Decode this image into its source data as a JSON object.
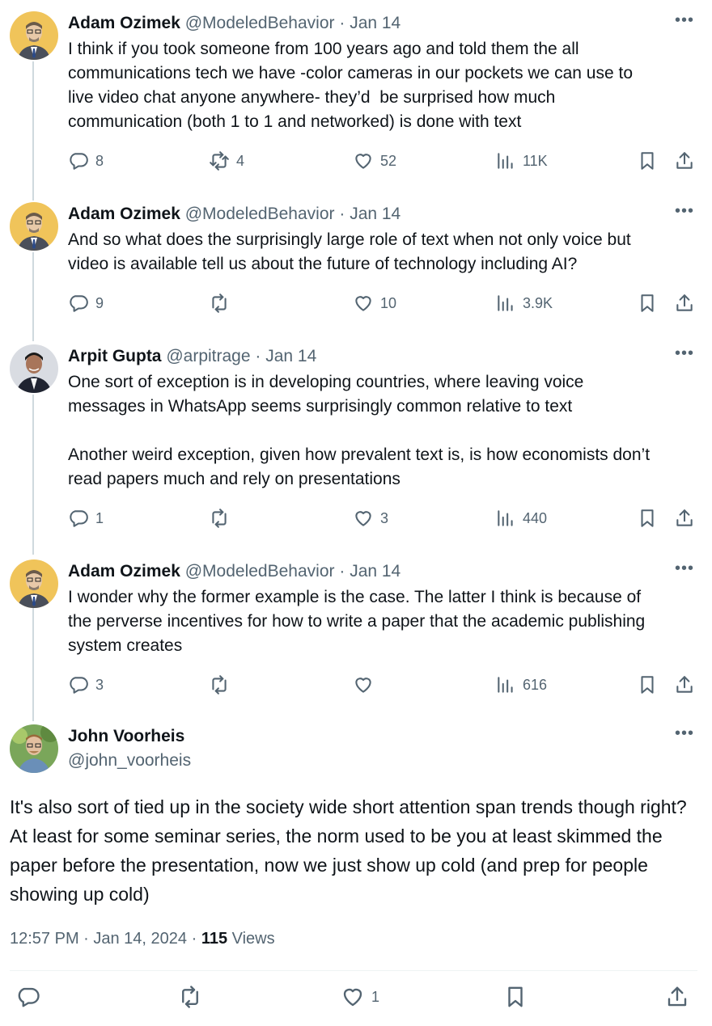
{
  "tweets": [
    {
      "name": "Adam Ozimek",
      "handle": "@ModeledBehavior",
      "dot": "·",
      "date": "Jan 14",
      "more": "•••",
      "text": "I think if you took someone from 100 years ago and told them the all\ncommunications tech we have -color cameras in our pockets we can use to\nlive video chat anyone anywhere- they’d  be surprised how much\ncommunication (both 1 to 1 and networked) is done with text",
      "replies": "8",
      "retweets": "4",
      "likes": "52",
      "views": "11K"
    },
    {
      "name": "Adam Ozimek",
      "handle": "@ModeledBehavior",
      "dot": "·",
      "date": "Jan 14",
      "more": "•••",
      "text": "And so what does the surprisingly large role of text when not only voice but\nvideo is available tell us about the future of technology including AI?",
      "replies": "9",
      "retweets": "",
      "likes": "10",
      "views": "3.9K"
    },
    {
      "name": "Arpit Gupta",
      "handle": "@arpitrage",
      "dot": "·",
      "date": "Jan 14",
      "more": "•••",
      "text": "One sort of exception is in developing countries, where leaving voice\nmessages in WhatsApp seems surprisingly common relative to text\n\nAnother weird exception, given how prevalent text is, is how economists don’t\nread papers much and rely on presentations",
      "replies": "1",
      "retweets": "",
      "likes": "3",
      "views": "440"
    },
    {
      "name": "Adam Ozimek",
      "handle": "@ModeledBehavior",
      "dot": "·",
      "date": "Jan 14",
      "more": "•••",
      "text": "I wonder why the former example is the case. The latter I think is because of\nthe perverse incentives for how to write a paper that the academic publishing\nsystem creates",
      "replies": "3",
      "retweets": "",
      "likes": "",
      "views": "616"
    }
  ],
  "main": {
    "name": "John Voorheis",
    "handle": "@john_voorheis",
    "more": "•••",
    "text": "It's also sort of tied up in the society wide short attention span trends though right? At least for some seminar series, the norm used to be you at least skimmed the paper before the presentation, now we just show up cold (and prep for people showing up cold)",
    "time": "12:57 PM · Jan 14, 2024 · ",
    "views_count": "115",
    "views_label": " Views",
    "likes": "1"
  },
  "icons": {
    "reply": "reply-icon",
    "retweet": "retweet-icon",
    "like": "heart-icon",
    "views": "views-bar-chart-icon",
    "bookmark": "bookmark-icon",
    "share": "share-icon"
  },
  "colors": {
    "text": "#0f1419",
    "secondary": "#536471",
    "thread_line": "#cfd9de"
  }
}
